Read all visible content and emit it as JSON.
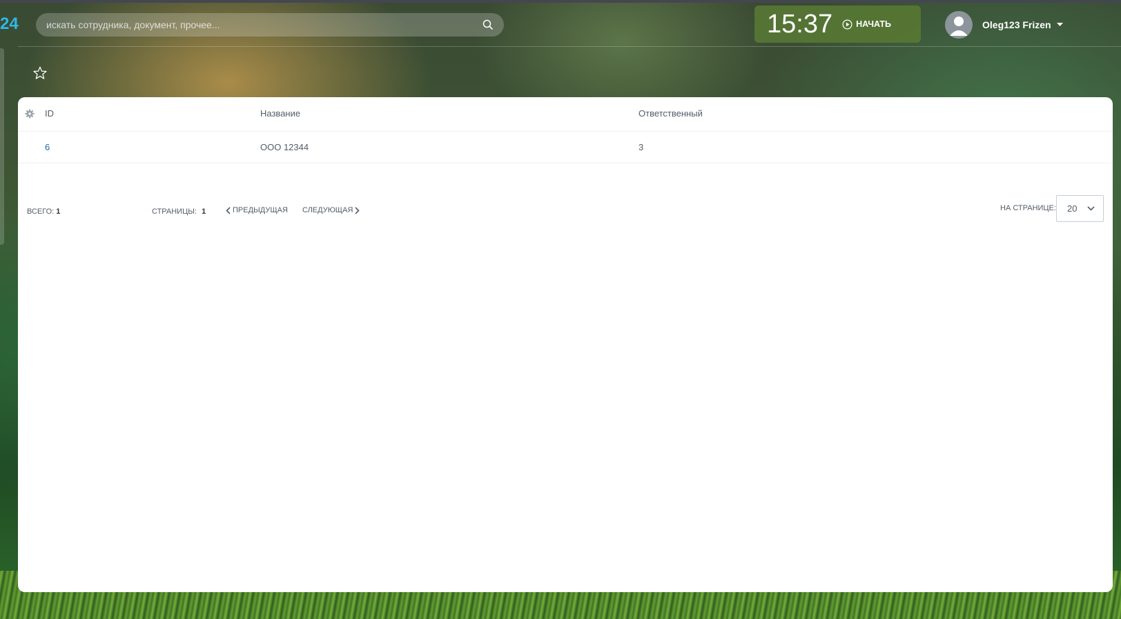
{
  "header": {
    "logo_fragment": "24",
    "search": {
      "placeholder": "искать сотрудника, документ, прочее...",
      "value": ""
    },
    "timer": {
      "time": "15:37",
      "start_label": "НАЧАТЬ"
    },
    "user": {
      "name": "Oleg123 Frizen"
    }
  },
  "table": {
    "columns": [
      "ID",
      "Название",
      "Ответственный"
    ],
    "rows": [
      {
        "id": "6",
        "name": "ООО 12344",
        "responsible": "3"
      }
    ]
  },
  "pagination": {
    "total_label": "ВСЕГО:",
    "total_value": "1",
    "pages_label": "СТРАНИЦЫ:",
    "pages_value": "1",
    "prev_label": "ПРЕДЫДУЩАЯ",
    "next_label": "СЛЕДУЮЩАЯ",
    "per_page_label": "НА СТРАНИЦЕ:",
    "per_page_value": "20"
  },
  "colors": {
    "accent_blue": "#2fb8ea",
    "timer_green": "#587834",
    "link_blue": "#2067b0"
  },
  "icons": [
    "search-icon",
    "play-icon",
    "user-avatar-icon",
    "caret-down-icon",
    "star-icon",
    "gear-icon",
    "chevron-left-icon",
    "chevron-right-icon",
    "chevron-down-icon"
  ]
}
